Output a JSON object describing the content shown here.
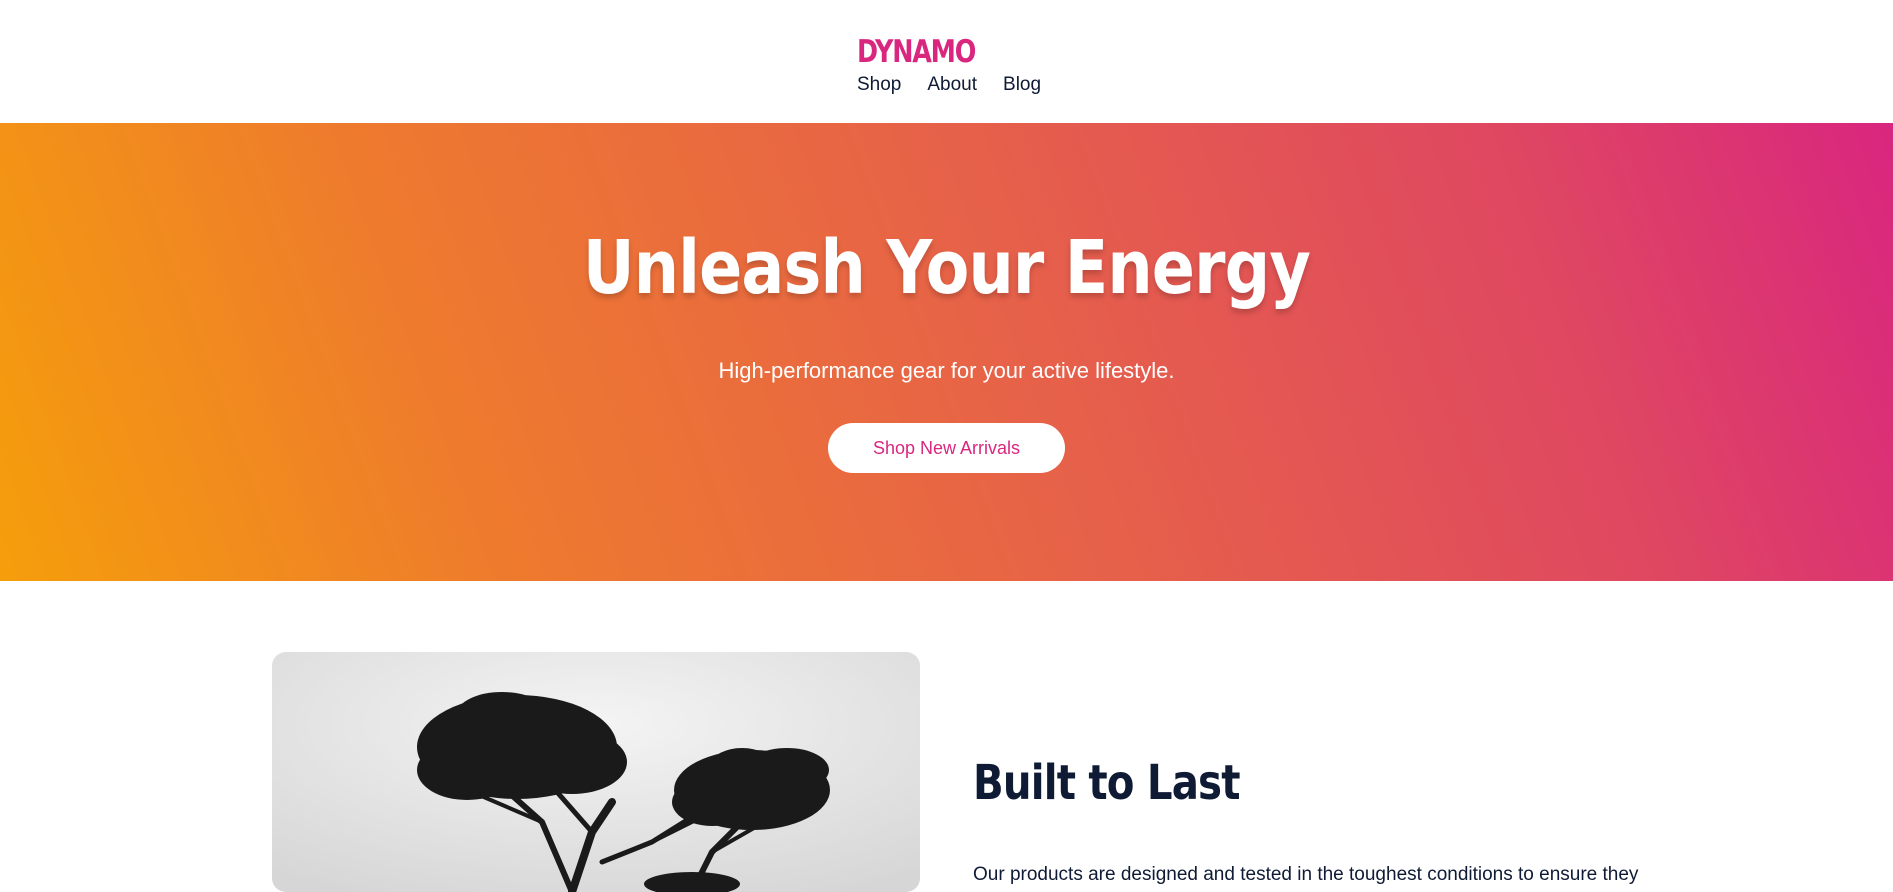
{
  "header": {
    "logo": "DYNAMO",
    "nav": [
      {
        "label": "Shop"
      },
      {
        "label": "About"
      },
      {
        "label": "Blog"
      }
    ]
  },
  "hero": {
    "title": "Unleash Your Energy",
    "subtitle": "High-performance gear for your active lifestyle.",
    "cta_label": "Shop New Arrivals"
  },
  "feature": {
    "image_description_icon": "tree-silhouette-image",
    "title": "Built to Last",
    "text": "Our products are designed and tested in the toughest conditions to ensure they"
  },
  "colors": {
    "brand": "#d9267f",
    "gradient_start": "#f59e0b",
    "gradient_end": "#d9267f",
    "text_dark": "#0f1b35",
    "white": "#ffffff"
  }
}
